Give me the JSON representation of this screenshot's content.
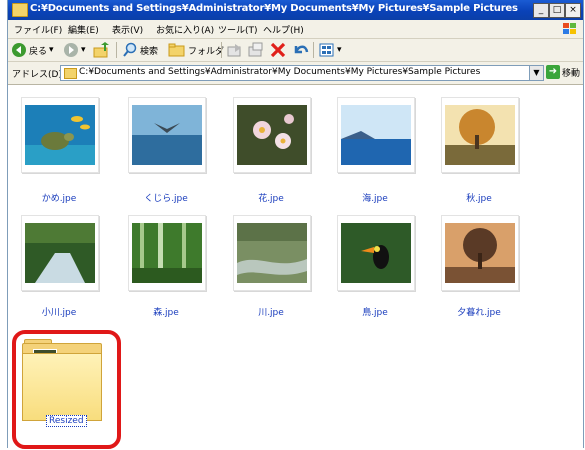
{
  "window": {
    "title": "C:¥Documents and Settings¥Administrator¥My Documents¥My Pictures¥Sample Pictures",
    "controls": {
      "minimize": "_",
      "maximize": "□",
      "close": "×"
    }
  },
  "menu": [
    "ファイル(F)",
    "編集(E)",
    "表示(V)",
    "お気に入り(A)",
    "ツール(T)",
    "ヘルプ(H)"
  ],
  "toolbar": {
    "back": "戻る",
    "search": "検索",
    "folders": "フォルダ"
  },
  "address": {
    "label": "アドレス(D)",
    "path": "C:¥Documents and Settings¥Administrator¥My Documents¥My Pictures¥Sample Pictures",
    "go": "移動"
  },
  "files": [
    {
      "name": "かめ.jpe"
    },
    {
      "name": "くじら.jpe"
    },
    {
      "name": "花.jpe"
    },
    {
      "name": "海.jpe"
    },
    {
      "name": "秋.jpe"
    },
    {
      "name": "小川.jpe"
    },
    {
      "name": "森.jpe"
    },
    {
      "name": "川.jpe"
    },
    {
      "name": "鳥.jpe"
    },
    {
      "name": "夕暮れ.jpe"
    }
  ],
  "folder": {
    "name": "Resized"
  },
  "colors": {
    "highlight": "#e01818",
    "link": "#1a3dbd",
    "titlebar": "#0a42b8"
  }
}
